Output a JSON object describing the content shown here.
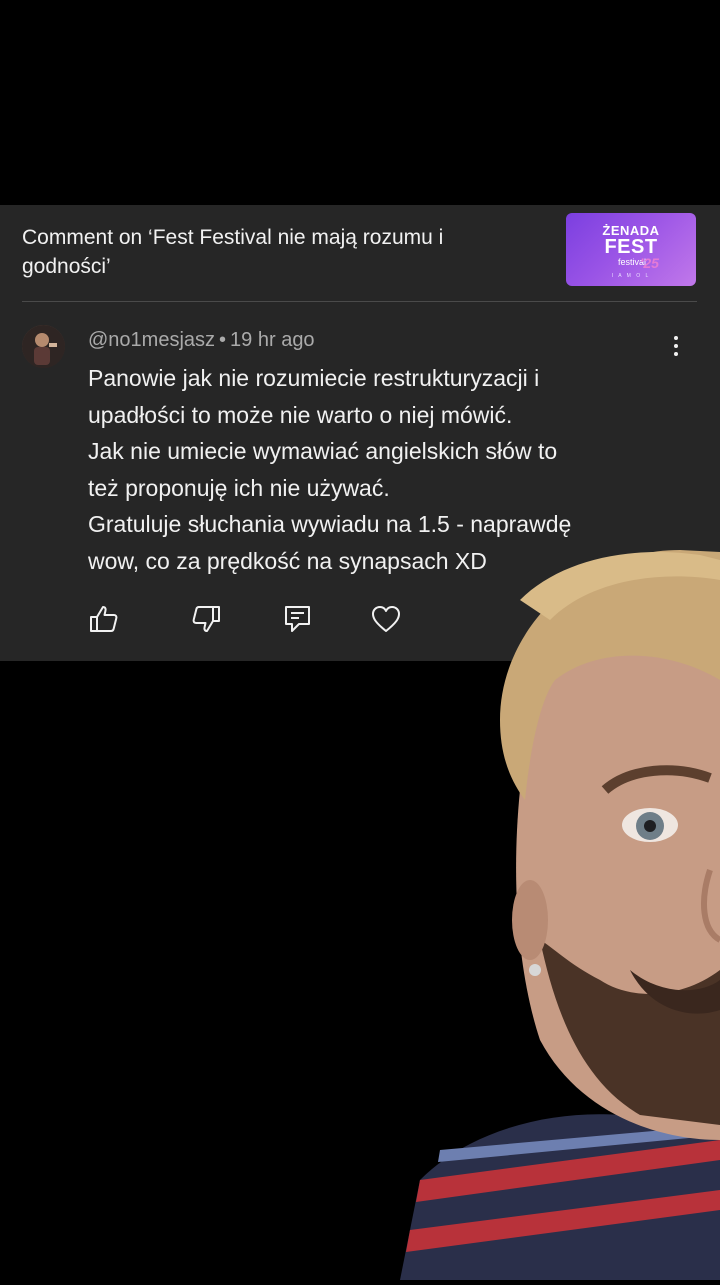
{
  "header": {
    "title": "Comment on ‘Fest Festival nie mają rozumu i godności’",
    "thumbnail": {
      "line1": "ŻENADA",
      "line2": "FEST",
      "line3": "festival",
      "line4": "'25",
      "line5": "I A M O L"
    }
  },
  "comment": {
    "author": "@no1mesjasz",
    "separator": "•",
    "time": "19 hr ago",
    "lines": [
      "Panowie jak nie rozumiecie restrukturyzacji i",
      "upadłości to może nie warto o niej mówić.",
      "Jak nie umiecie wymawiać angielskich słów to",
      "też proponuję ich nie używać.",
      "Gratuluje słuchania wywiadu na 1.5 - naprawdę",
      "wow, co za prędkość na synapsach XD"
    ]
  },
  "actions": {
    "icons": [
      "thumb-up-icon",
      "thumb-down-icon",
      "reply-icon",
      "heart-icon",
      "more-vertical-icon"
    ]
  },
  "colors": {
    "background": "#000000",
    "card": "#262626",
    "text_primary": "#f1f1f1",
    "text_secondary": "#aaaaaa",
    "thumbnail_purple": "#8a4ae3"
  }
}
